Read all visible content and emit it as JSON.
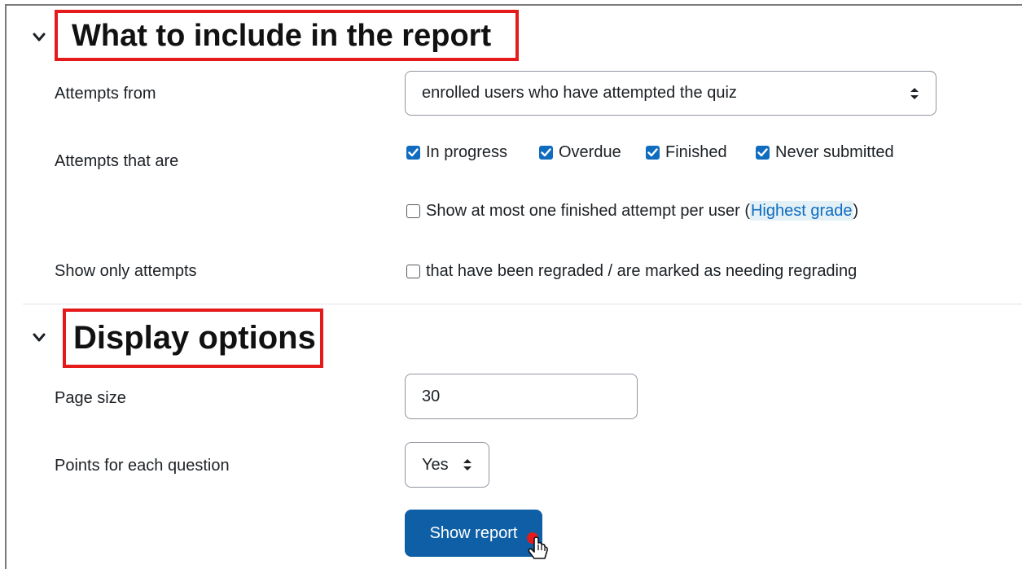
{
  "sections": {
    "include": {
      "title": "What to include in the report"
    },
    "display": {
      "title": "Display options"
    }
  },
  "fields": {
    "attempts_from": {
      "label": "Attempts from",
      "value": "enrolled users who have attempted the quiz"
    },
    "attempts_that_are": {
      "label": "Attempts that are",
      "options": [
        {
          "label": "In progress",
          "checked": true
        },
        {
          "label": "Overdue",
          "checked": true
        },
        {
          "label": "Finished",
          "checked": true
        },
        {
          "label": "Never submitted",
          "checked": true
        }
      ],
      "one_attempt": {
        "checked": false,
        "text_before": "Show at most one finished attempt per user (",
        "link": "Highest grade",
        "text_after": ")"
      }
    },
    "show_only": {
      "label": "Show only attempts",
      "checked": false,
      "text": "that have been regraded / are marked as needing regrading"
    },
    "page_size": {
      "label": "Page size",
      "value": "30"
    },
    "points": {
      "label": "Points for each question",
      "value": "Yes"
    }
  },
  "submit": {
    "label": "Show report"
  },
  "colors": {
    "highlight_box": "#e51a1a",
    "primary": "#0f6cbf",
    "button": "#0f5fa6",
    "link_bg": "#e3f1f7",
    "cursor_dot": "#e51a1a"
  },
  "icons": {
    "section_toggle": "chevron-down-icon",
    "select_caret": "sort-caret-icon",
    "checkbox_check": "check-icon",
    "pointer": "hand-pointer-cursor-icon"
  }
}
